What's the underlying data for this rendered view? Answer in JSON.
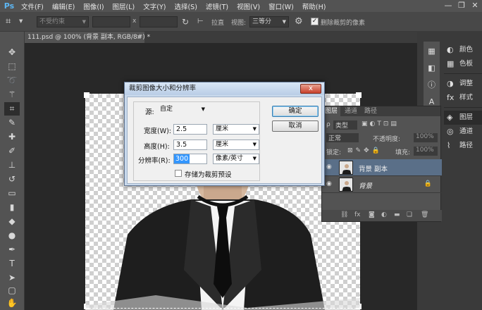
{
  "app": {
    "logo": "Ps"
  },
  "menu": [
    "文件(F)",
    "编辑(E)",
    "图像(I)",
    "图层(L)",
    "文字(Y)",
    "选择(S)",
    "滤镜(T)",
    "视图(V)",
    "窗口(W)",
    "帮助(H)"
  ],
  "window_controls": {
    "minimize": "—",
    "restore": "❐",
    "close": "✕"
  },
  "options": {
    "ratio_value": "不受约束",
    "swap_symbol": "x",
    "straighten_label": "拉直",
    "view_label": "视图:",
    "view_value": "三等分",
    "delete_pixels_label": "删除裁剪的像素",
    "delete_pixels_checked": true
  },
  "document_tab": {
    "title": "111.psd @ 100% (背景 副本, RGB/8#) *",
    "close": "×"
  },
  "dialog": {
    "title": "裁剪图像大小和分辨率",
    "close": "x",
    "source_label": "源:",
    "source_value": "自定",
    "width_label": "宽度(W):",
    "width_value": "2.5",
    "width_unit": "厘米",
    "height_label": "高度(H):",
    "height_value": "3.5",
    "height_unit": "厘米",
    "resolution_label": "分辨率(R):",
    "resolution_value": "300",
    "resolution_unit": "像素/英寸",
    "save_preset_label": "存储为裁剪预设",
    "ok_label": "确定",
    "cancel_label": "取消"
  },
  "layers_panel": {
    "tabs": [
      "图层",
      "通道",
      "路径"
    ],
    "kind_label": "类型",
    "blend_mode": "正常",
    "opacity_label": "不透明度:",
    "opacity_value": "100%",
    "lock_label": "锁定:",
    "fill_label": "填充:",
    "fill_value": "100%",
    "layers": [
      {
        "name": "背景 副本",
        "active": true
      },
      {
        "name": "背景",
        "active": false,
        "locked": true
      }
    ],
    "footer_icons": [
      "link-icon",
      "fx-icon",
      "mask-icon",
      "adjustment-icon",
      "group-icon",
      "new-layer-icon",
      "trash-icon"
    ]
  },
  "side_panels": [
    {
      "label": "颜色",
      "icon": "color-icon"
    },
    {
      "label": "色板",
      "icon": "swatches-icon"
    },
    {
      "label": "调整",
      "icon": "adjustments-icon"
    },
    {
      "label": "样式",
      "icon": "styles-icon"
    },
    {
      "label": "图层",
      "icon": "layers-icon",
      "active": true
    },
    {
      "label": "通道",
      "icon": "channels-icon"
    },
    {
      "label": "路径",
      "icon": "paths-icon"
    }
  ],
  "colors": {
    "accent": "#3296ff",
    "panel": "#535353",
    "dialog_frame": "#c9d9ec"
  }
}
